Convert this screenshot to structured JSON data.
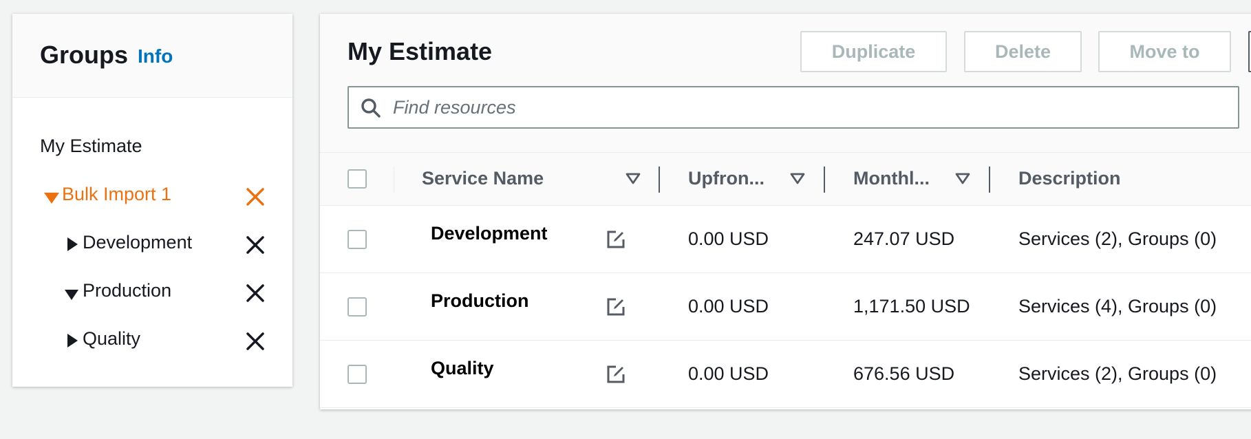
{
  "groups_panel": {
    "title": "Groups",
    "info_link": "Info",
    "tree": {
      "root": "My Estimate",
      "bulk_import": "Bulk Import 1",
      "children": [
        "Development",
        "Production",
        "Quality"
      ]
    }
  },
  "estimate": {
    "title": "My Estimate",
    "actions": {
      "duplicate": "Duplicate",
      "delete": "Delete",
      "move_to": "Move to"
    },
    "search": {
      "placeholder": "Find resources",
      "value": ""
    },
    "columns": {
      "service_name": "Service Name",
      "upfront": "Upfron...",
      "monthly": "Monthl...",
      "description": "Description"
    },
    "rows": [
      {
        "name": "Development",
        "upfront": "0.00 USD",
        "monthly": "247.07 USD",
        "description": "Services (2), Groups (0)"
      },
      {
        "name": "Production",
        "upfront": "0.00 USD",
        "monthly": "1,171.50 USD",
        "description": "Services (4), Groups (0)"
      },
      {
        "name": "Quality",
        "upfront": "0.00 USD",
        "monthly": "676.56 USD",
        "description": "Services (2), Groups (0)"
      }
    ]
  },
  "colors": {
    "accent_orange": "#ec7211",
    "link_blue": "#0073bb",
    "disabled_text": "#aab7b8"
  },
  "icons": {
    "tree_expanded": "caret-down-icon",
    "tree_collapsed": "caret-right-icon",
    "remove": "close-icon",
    "edit": "edit-icon",
    "search": "search-icon",
    "sort": "sort-down-icon"
  }
}
